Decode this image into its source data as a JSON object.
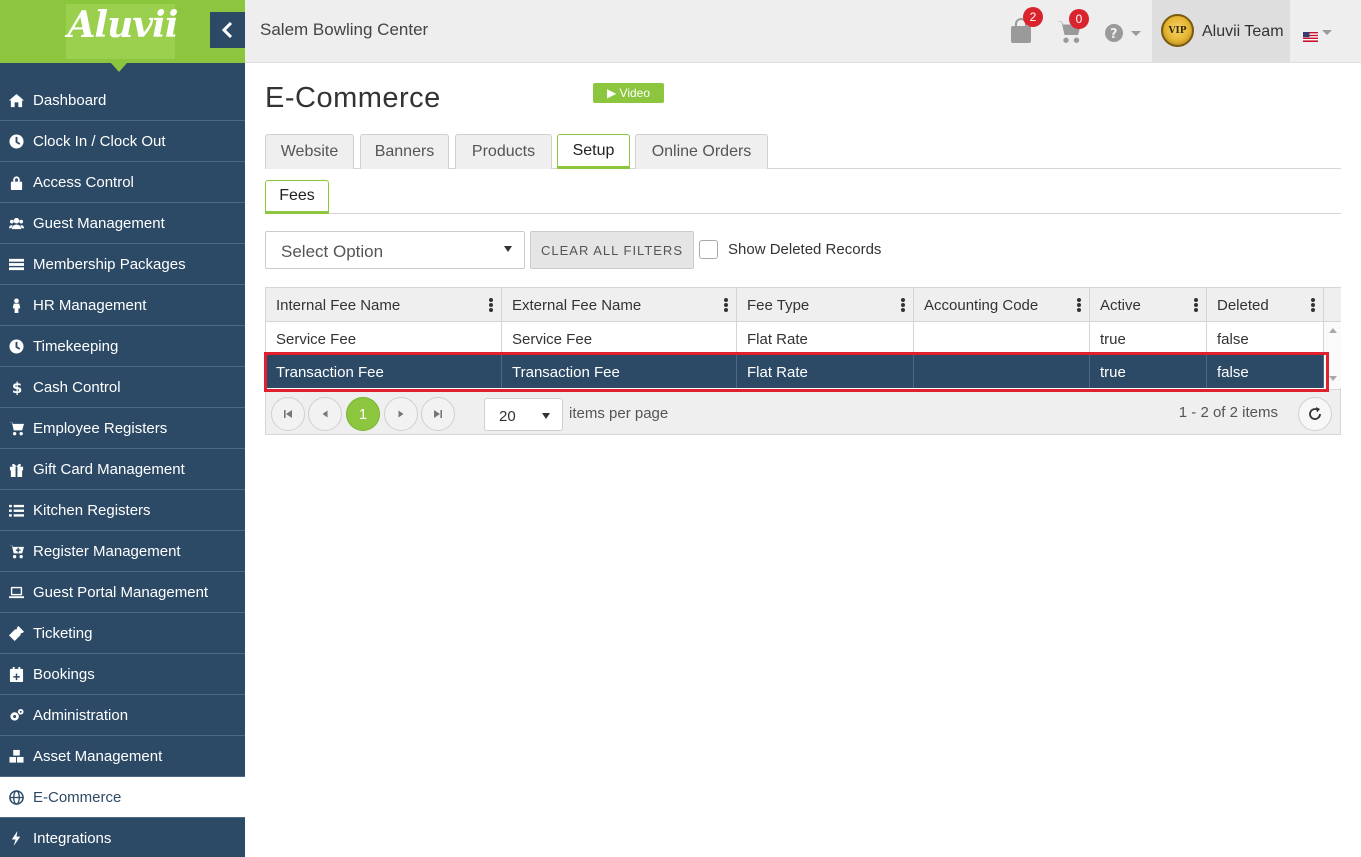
{
  "app": {
    "logo_text": "Aluvii",
    "center_name": "Salem Bowling Center",
    "colors": {
      "brand_green": "#8cc63f",
      "sidebar_navy": "#2c4a66",
      "selected_row": "#2c4a66",
      "badge_red": "#d9232d",
      "highlight_outline": "#e0202c"
    }
  },
  "topbar": {
    "bag_count": "2",
    "cart_count": "0",
    "help_icon": "question-circle-icon",
    "user_name": "Aluvii Team",
    "avatar_text": "VIP",
    "language_flag": "us-flag-icon"
  },
  "sidebar": {
    "items": [
      {
        "label": "Dashboard",
        "icon": "home-icon"
      },
      {
        "label": "Clock In / Clock Out",
        "icon": "clock-icon"
      },
      {
        "label": "Access Control",
        "icon": "lock-icon"
      },
      {
        "label": "Guest Management",
        "icon": "users-icon"
      },
      {
        "label": "Membership Packages",
        "icon": "list-card-icon"
      },
      {
        "label": "HR Management",
        "icon": "person-icon"
      },
      {
        "label": "Timekeeping",
        "icon": "clock-icon"
      },
      {
        "label": "Cash Control",
        "icon": "dollar-icon"
      },
      {
        "label": "Employee Registers",
        "icon": "cart-icon"
      },
      {
        "label": "Gift Card Management",
        "icon": "gift-icon"
      },
      {
        "label": "Kitchen Registers",
        "icon": "checklist-icon"
      },
      {
        "label": "Register Management",
        "icon": "cart-plus-icon"
      },
      {
        "label": "Guest Portal Management",
        "icon": "laptop-icon"
      },
      {
        "label": "Ticketing",
        "icon": "ticket-icon"
      },
      {
        "label": "Bookings",
        "icon": "calendar-plus-icon"
      },
      {
        "label": "Administration",
        "icon": "cogs-icon"
      },
      {
        "label": "Asset Management",
        "icon": "cubes-icon"
      },
      {
        "label": "E-Commerce",
        "icon": "globe-icon",
        "active": true
      },
      {
        "label": "Integrations",
        "icon": "bolt-icon"
      }
    ]
  },
  "main": {
    "title": "E-Commerce",
    "video_label": "▶ Video",
    "tabs": [
      "Website",
      "Banners",
      "Products",
      "Setup",
      "Online Orders"
    ],
    "active_tab": "Setup",
    "subtabs": [
      "Fees"
    ],
    "filters": {
      "select_placeholder": "Select Option",
      "clear_label": "CLEAR ALL FILTERS",
      "show_deleted_label": "Show Deleted Records",
      "show_deleted_checked": false
    },
    "grid": {
      "columns": [
        "Internal Fee Name",
        "External Fee Name",
        "Fee Type",
        "Accounting Code",
        "Active",
        "Deleted"
      ],
      "rows": [
        {
          "internal": "Service Fee",
          "external": "Service Fee",
          "fee_type": "Flat Rate",
          "accounting_code": "",
          "active": "true",
          "deleted": "false",
          "selected": false
        },
        {
          "internal": "Transaction Fee",
          "external": "Transaction Fee",
          "fee_type": "Flat Rate",
          "accounting_code": "",
          "active": "true",
          "deleted": "false",
          "selected": true
        }
      ],
      "pager": {
        "current_page": "1",
        "page_size": "20",
        "items_per_page_label": "items per page",
        "count_label": "1 - 2 of 2 items"
      }
    }
  }
}
